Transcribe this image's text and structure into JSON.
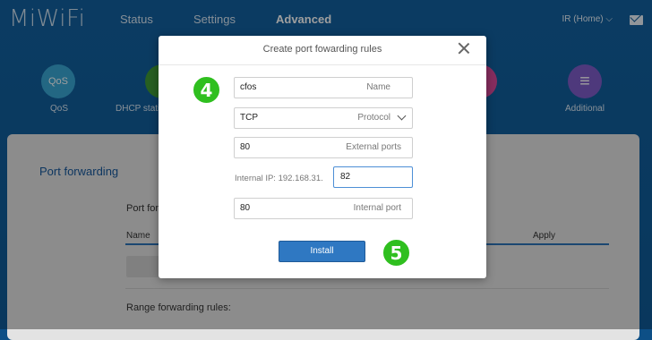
{
  "header": {
    "logo": "MiWiFi",
    "nav": [
      "Status",
      "Settings",
      "Advanced"
    ],
    "active_nav": "Advanced",
    "network_selector": "IR (Home)"
  },
  "features": [
    {
      "icon": "QoS",
      "label": "QoS",
      "color": "#39a6d4"
    },
    {
      "icon": "",
      "label": "DHCP static",
      "color": "#3f9a36"
    },
    {
      "icon": "",
      "label": "",
      "color": "#d84a9a"
    },
    {
      "icon": "≡",
      "label": "Additional",
      "color": "#7e5cc8"
    }
  ],
  "page": {
    "section_title": "Port forwarding",
    "subtitle": "Port forv",
    "columns": {
      "name": "Name",
      "apply": "Apply"
    },
    "range_rules": "Range forwarding rules:"
  },
  "dialog": {
    "title": "Create port fowarding rules",
    "name": {
      "value": "cfos",
      "label": "Name"
    },
    "protocol": {
      "value": "TCP",
      "label": "Protocol"
    },
    "external_ports": {
      "value": "80",
      "label": "External ports"
    },
    "internal_ip": {
      "prefix": "Internal IP: 192.168.31.",
      "value": "82"
    },
    "internal_port": {
      "value": "80",
      "label": "Internal port"
    },
    "install_label": "Install"
  },
  "badges": {
    "step1": "4",
    "step2": "5"
  },
  "colors": {
    "accent": "#2f78c2",
    "badge": "#2fbf1f"
  }
}
